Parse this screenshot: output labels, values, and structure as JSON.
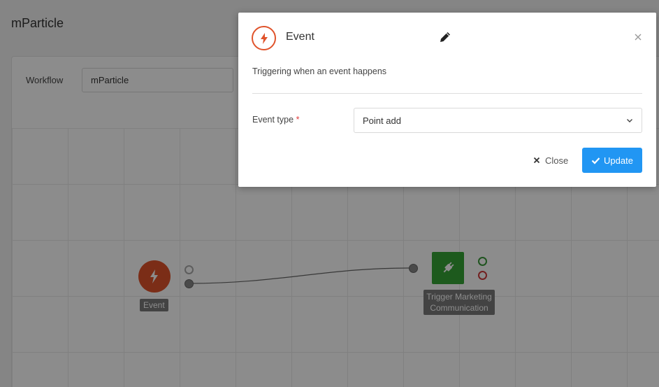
{
  "app": {
    "title": "mParticle"
  },
  "workflow": {
    "label": "Workflow",
    "name_value": "mParticle"
  },
  "canvas": {
    "nodes": [
      {
        "label": "Event",
        "icon": "lightning-icon",
        "color": "#e0532b"
      },
      {
        "label": "Trigger Marketing Communication",
        "icon": "plug-icon",
        "color": "#35a535"
      }
    ]
  },
  "modal": {
    "title": "Event",
    "icon": "lightning-icon",
    "subtitle": "Triggering when an event happens",
    "field": {
      "label": "Event type",
      "required_mark": "*",
      "value": "Point add"
    },
    "buttons": {
      "close_label": "Close",
      "update_label": "Update"
    }
  },
  "colors": {
    "accent": "#2196f3",
    "event": "#e0532b",
    "action": "#35a535",
    "required": "#e03c3c"
  }
}
